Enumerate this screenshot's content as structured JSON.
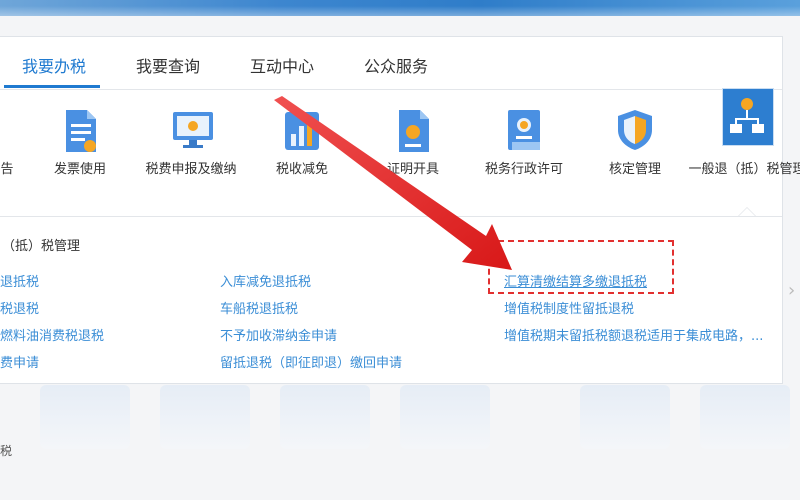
{
  "tabs": [
    {
      "label": "我要办税",
      "active": true
    },
    {
      "label": "我要查询",
      "active": false
    },
    {
      "label": "互动中心",
      "active": false
    },
    {
      "label": "公众服务",
      "active": false
    }
  ],
  "icons": [
    {
      "label": "告",
      "icon": "declaration-icon"
    },
    {
      "label": "发票使用",
      "icon": "invoice-document-icon"
    },
    {
      "label": "税费申报及缴纳",
      "icon": "monitor-icon"
    },
    {
      "label": "税收减免",
      "icon": "bar-chart-icon"
    },
    {
      "label": "证明开具",
      "icon": "certificate-document-icon"
    },
    {
      "label": "税务行政许可",
      "icon": "license-icon"
    },
    {
      "label": "核定管理",
      "icon": "shield-icon"
    },
    {
      "label": "一般退（抵）税管理",
      "icon": "org-chart-icon"
    }
  ],
  "section": {
    "title": "（抵）税管理"
  },
  "links": {
    "col1": [
      "退抵税",
      "税退税",
      "燃料油消费税退税",
      "费申请"
    ],
    "col2": [
      "入库减免退抵税",
      "车船税退抵税",
      "不予加收滞纳金申请",
      "留抵退税（即征即退）缴回申请"
    ],
    "col3": [
      "汇算清缴结算多缴退抵税",
      "增值税制度性留抵退税",
      "增值税期末留抵税额退税适用于集成电路，..."
    ]
  },
  "bottom": {
    "tiny_label": "税"
  },
  "colors": {
    "accent": "#1f7ad0",
    "link": "#3b8ed6",
    "highlight": "#e23030"
  }
}
